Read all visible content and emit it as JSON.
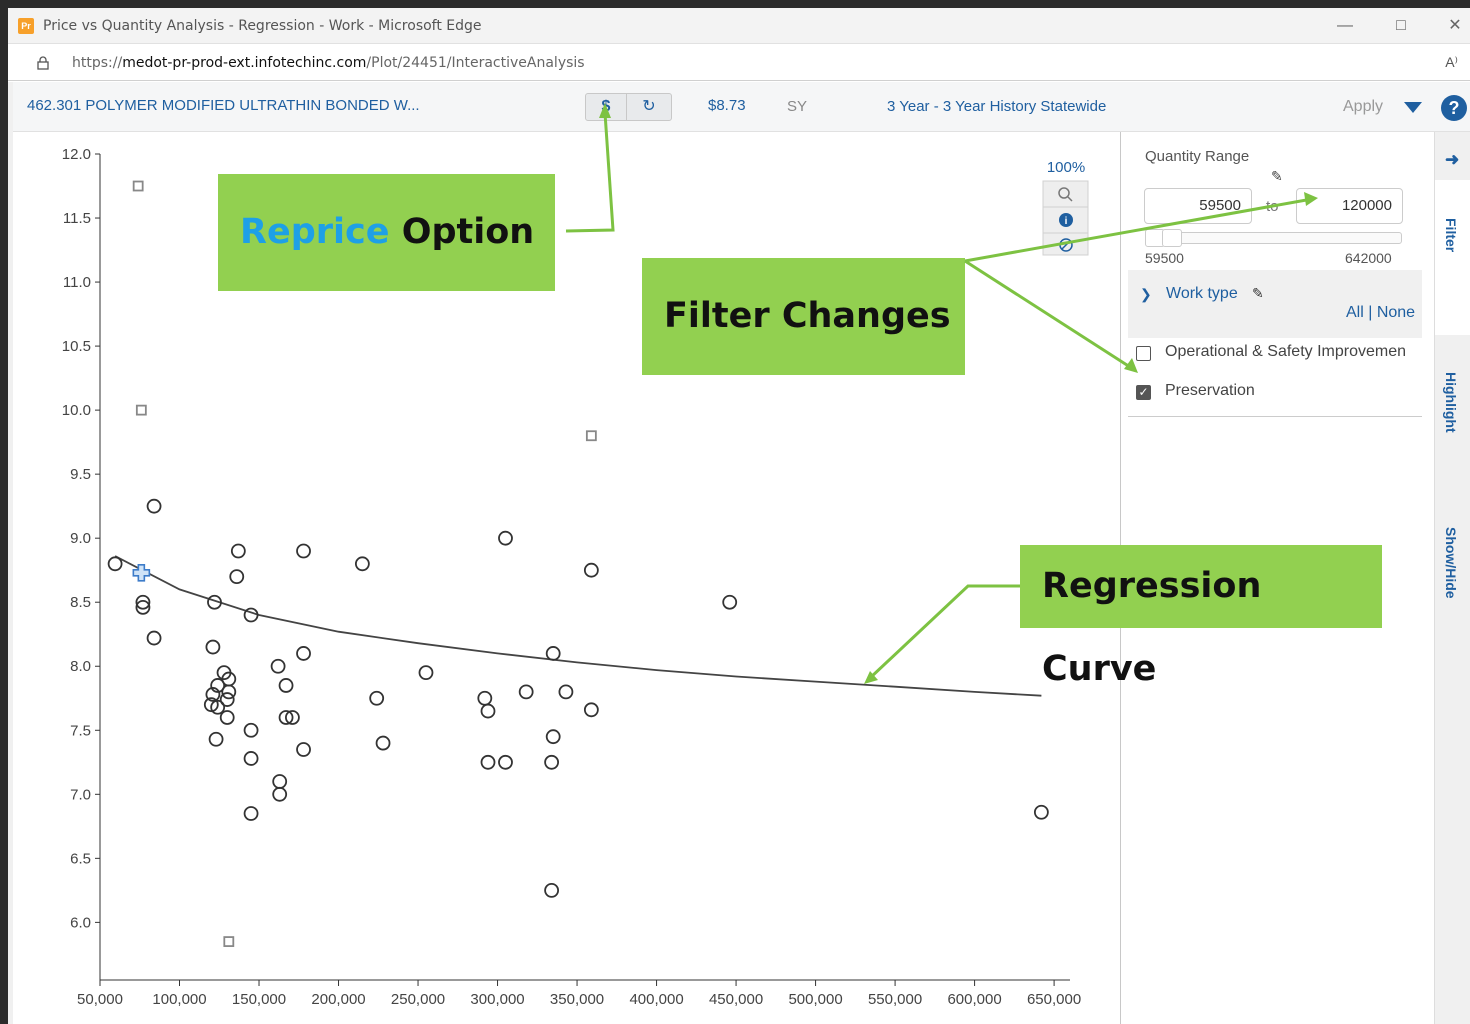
{
  "window": {
    "title": "Price vs Quantity Analysis - Regression - Work - Microsoft Edge",
    "logo_text": "Pr"
  },
  "address_bar": {
    "url_prefix": "https://",
    "url_host": "medot-pr-prod-ext.infotechinc.com",
    "url_path": "/Plot/24451/InteractiveAnalysis",
    "read_aloud": "A⁾"
  },
  "toolbar": {
    "item_title": "462.301 POLYMER MODIFIED ULTRATHIN BONDED W...",
    "reprice_icon": "$",
    "refresh_icon": "↻",
    "price": "$8.73",
    "unit": "SY",
    "history": "3 Year - 3 Year History Statewide",
    "apply_label": "Apply",
    "help_icon": "?"
  },
  "chart_controls": {
    "zoom_level": "100%"
  },
  "side_panel": {
    "quantity_range_label": "Quantity Range",
    "min_value": "59500",
    "max_value": "120000",
    "to_label": "to",
    "slider_min_label": "59500",
    "slider_max_label": "642000",
    "work_type_label": "Work type",
    "all_none": "All | None",
    "options": [
      {
        "label": "Operational & Safety Improvemen",
        "checked": false
      },
      {
        "label": "Preservation",
        "checked": true
      }
    ]
  },
  "vertical_tabs": {
    "filter": "Filter",
    "highlight": "Highlight",
    "show_hide": "Show/Hide"
  },
  "callouts": {
    "reprice_word1": "Reprice",
    "reprice_word2": "Option",
    "filter": "Filter Changes",
    "regression": "Regression Curve"
  },
  "colors": {
    "brand_blue": "#1f5fa0",
    "callout_green": "#92d050",
    "reprice_highlight": "#1ea0e6"
  },
  "chart_data": {
    "type": "scatter",
    "xlim": [
      50000,
      660000
    ],
    "ylim": [
      5.55,
      12.0
    ],
    "x_ticks": [
      50000,
      100000,
      150000,
      200000,
      250000,
      300000,
      350000,
      400000,
      450000,
      500000,
      550000,
      600000,
      650000
    ],
    "x_tick_labels": [
      "50,000",
      "100,000",
      "150,000",
      "200,000",
      "250,000",
      "300,000",
      "350,000",
      "400,000",
      "450,000",
      "500,000",
      "550,000",
      "600,000",
      "650,000"
    ],
    "y_ticks": [
      6.0,
      6.5,
      7.0,
      7.5,
      8.0,
      8.5,
      9.0,
      9.5,
      10.0,
      10.5,
      11.0,
      11.5,
      12.0
    ],
    "y_tick_labels": [
      "6.0",
      "6.5",
      "7.0",
      "7.5",
      "8.0",
      "8.5",
      "9.0",
      "9.5",
      "10.0",
      "10.5",
      "11.0",
      "11.5",
      "12.0"
    ],
    "grid": false,
    "series": [
      {
        "marker": "circle",
        "points": [
          [
            59500,
            8.8
          ],
          [
            77000,
            8.5
          ],
          [
            77000,
            8.46
          ],
          [
            84000,
            9.25
          ],
          [
            84000,
            8.22
          ],
          [
            122000,
            8.5
          ],
          [
            121000,
            8.15
          ],
          [
            128000,
            7.95
          ],
          [
            131000,
            7.9
          ],
          [
            124000,
            7.85
          ],
          [
            121000,
            7.78
          ],
          [
            131000,
            7.8
          ],
          [
            130000,
            7.74
          ],
          [
            120000,
            7.7
          ],
          [
            124000,
            7.68
          ],
          [
            130000,
            7.6
          ],
          [
            123000,
            7.43
          ],
          [
            137000,
            8.9
          ],
          [
            136000,
            8.7
          ],
          [
            145000,
            8.4
          ],
          [
            145000,
            7.5
          ],
          [
            145000,
            7.28
          ],
          [
            145000,
            6.85
          ],
          [
            162000,
            8.0
          ],
          [
            167000,
            7.85
          ],
          [
            167000,
            7.6
          ],
          [
            171000,
            7.6
          ],
          [
            163000,
            7.1
          ],
          [
            163000,
            7.0
          ],
          [
            178000,
            8.9
          ],
          [
            178000,
            8.1
          ],
          [
            178000,
            7.35
          ],
          [
            215000,
            8.8
          ],
          [
            224000,
            7.75
          ],
          [
            228000,
            7.4
          ],
          [
            255000,
            7.95
          ],
          [
            292000,
            7.75
          ],
          [
            294000,
            7.65
          ],
          [
            294000,
            7.25
          ],
          [
            305000,
            7.25
          ],
          [
            305000,
            9.0
          ],
          [
            318000,
            7.8
          ],
          [
            335000,
            8.1
          ],
          [
            335000,
            7.45
          ],
          [
            334000,
            7.25
          ],
          [
            343000,
            7.8
          ],
          [
            334000,
            6.25
          ],
          [
            359000,
            8.75
          ],
          [
            359000,
            7.66
          ],
          [
            446000,
            8.5
          ],
          [
            642000,
            6.86
          ]
        ]
      },
      {
        "marker": "square",
        "points": [
          [
            74000,
            11.75
          ],
          [
            76000,
            10.0
          ],
          [
            359000,
            9.8
          ],
          [
            131000,
            5.85
          ]
        ]
      },
      {
        "marker": "plus",
        "points": [
          [
            76000,
            8.73
          ]
        ]
      }
    ],
    "regression_curve": [
      [
        59500,
        8.86
      ],
      [
        100000,
        8.6
      ],
      [
        150000,
        8.4
      ],
      [
        200000,
        8.27
      ],
      [
        250000,
        8.18
      ],
      [
        300000,
        8.1
      ],
      [
        350000,
        8.03
      ],
      [
        400000,
        7.97
      ],
      [
        450000,
        7.92
      ],
      [
        500000,
        7.88
      ],
      [
        550000,
        7.84
      ],
      [
        600000,
        7.8
      ],
      [
        642000,
        7.77
      ]
    ]
  }
}
